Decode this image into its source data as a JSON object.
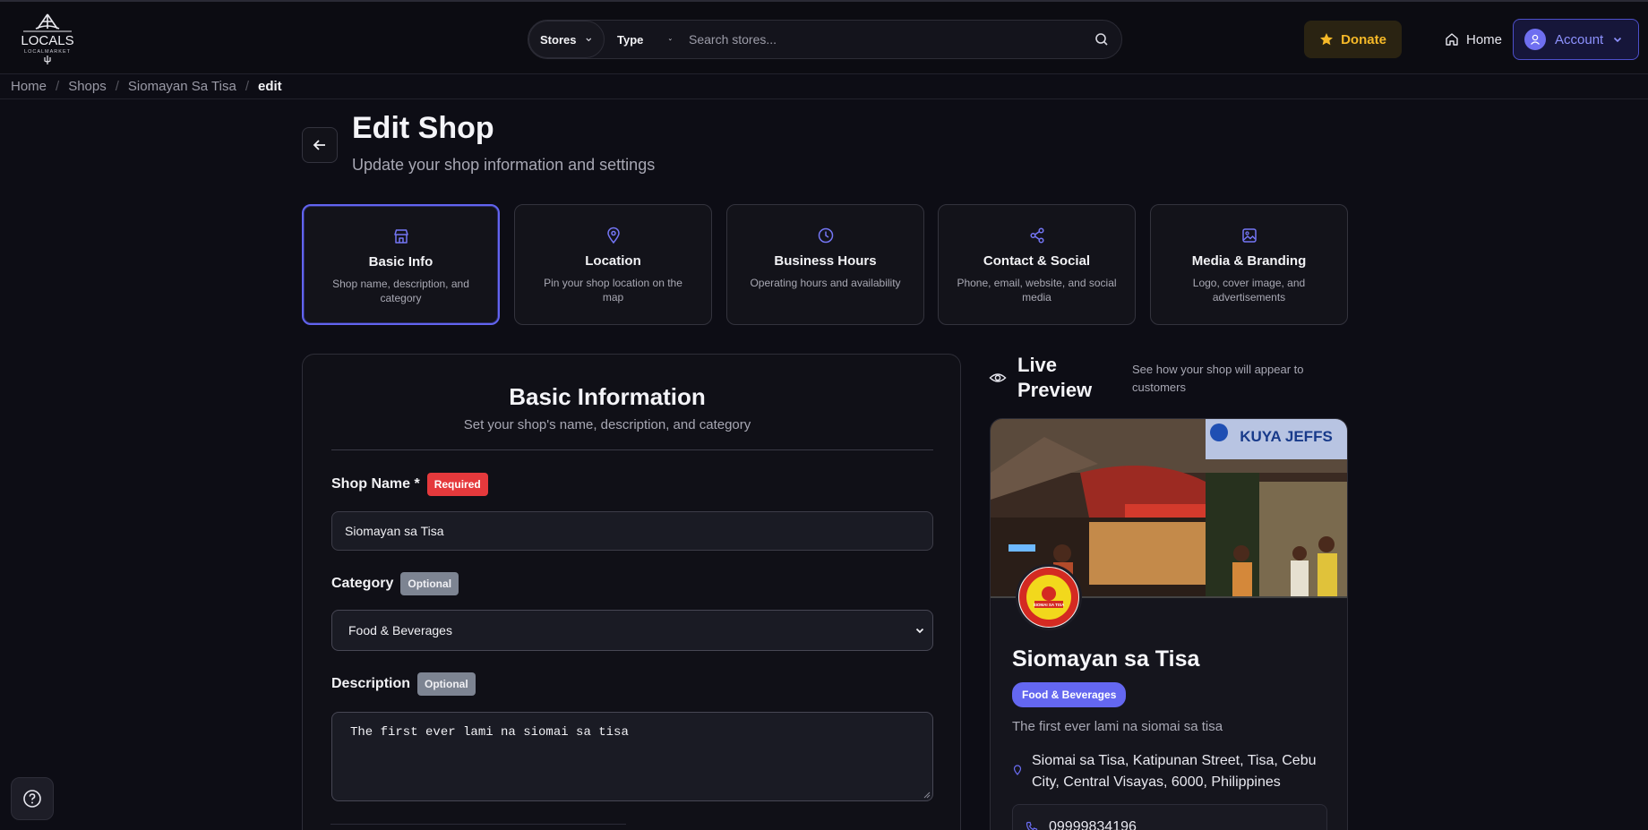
{
  "header": {
    "logo_text": "LOCALS",
    "logo_subtext": "LOCALMARKET",
    "stores_label": "Stores",
    "type_label": "Type",
    "search_placeholder": "Search stores...",
    "donate_label": "Donate",
    "home_label": "Home",
    "account_label": "Account"
  },
  "breadcrumb": {
    "items": [
      "Home",
      "Shops",
      "Siomayan Sa Tisa"
    ],
    "current": "edit"
  },
  "page": {
    "title": "Edit Shop",
    "subtitle": "Update your shop information and settings"
  },
  "tabs": [
    {
      "title": "Basic Info",
      "desc": "Shop name, description, and category",
      "icon": "store-icon",
      "active": true
    },
    {
      "title": "Location",
      "desc": "Pin your shop location on the map",
      "icon": "map-pin-icon",
      "active": false
    },
    {
      "title": "Business Hours",
      "desc": "Operating hours and availability",
      "icon": "clock-icon",
      "active": false
    },
    {
      "title": "Contact & Social",
      "desc": "Phone, email, website, and social media",
      "icon": "share-icon",
      "active": false
    },
    {
      "title": "Media & Branding",
      "desc": "Logo, cover image, and advertisements",
      "icon": "image-icon",
      "active": false
    }
  ],
  "form": {
    "title": "Basic Information",
    "subtitle": "Set your shop's name, description, and category",
    "shop_name_label": "Shop Name *",
    "required_badge": "Required",
    "shop_name_value": "Siomayan sa Tisa",
    "category_label": "Category",
    "optional_badge": "Optional",
    "category_value": "Food & Beverages",
    "description_label": "Description",
    "description_value": "The first ever lami na siomai sa tisa"
  },
  "preview": {
    "title": "Live Preview",
    "subtitle": "See how your shop will appear to customers",
    "cover_sign_text": "KUYA JEFFS",
    "logo_badge_text": "SIOMAI SA TISA",
    "shop_name": "Siomayan sa Tisa",
    "category": "Food & Beverages",
    "description": "The first ever lami na siomai sa tisa",
    "address": "Siomai sa Tisa, Katipunan Street, Tisa, Cebu City, Central Visayas, 6000, Philippines",
    "phone": "09999834196"
  },
  "colors": {
    "accent": "#6264f0",
    "donate": "#f6b928",
    "required": "#e5393c",
    "optional": "#7d8492"
  }
}
